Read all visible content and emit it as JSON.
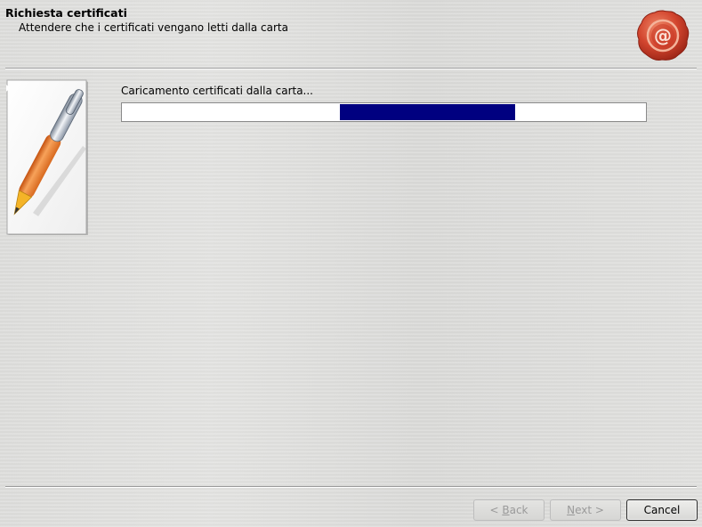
{
  "header": {
    "title": "Richiesta certificati",
    "subtitle": "Attendere che i certificati vengano letti dalla carta",
    "seal_icon": "wax-seal-at-icon"
  },
  "side_image": {
    "icon": "pen-icon"
  },
  "status": {
    "text": "Caricamento certificati dalla carta..."
  },
  "progress": {
    "mode": "busy-indicator",
    "chunk_start_fraction": 0.415,
    "chunk_end_fraction": 0.748,
    "color": "#000080"
  },
  "buttons": {
    "back": {
      "prefix": "< ",
      "mnemonic": "B",
      "rest": "ack",
      "enabled": false
    },
    "next": {
      "mnemonic": "N",
      "rest": "ext >",
      "enabled": false
    },
    "cancel": {
      "label": "Cancel",
      "enabled": true
    }
  }
}
